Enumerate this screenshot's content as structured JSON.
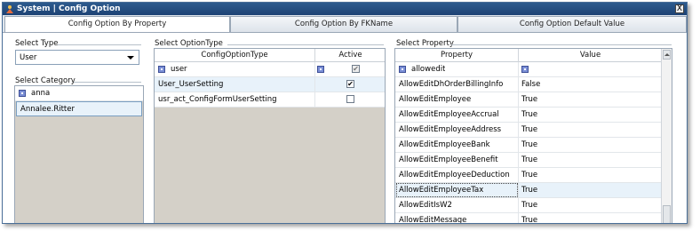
{
  "window": {
    "title": "System | Config Option",
    "close_label": "X"
  },
  "tabs": [
    {
      "label": "Config Option By Property"
    },
    {
      "label": "Config Option By FKName"
    },
    {
      "label": "Config Option Default Value"
    }
  ],
  "select_type": {
    "label": "Select Type",
    "value": "User"
  },
  "select_category": {
    "label": "Select Category",
    "filter_value": "anna",
    "items": [
      "Annalee.Ritter"
    ]
  },
  "select_option_type": {
    "label": "Select OptionType",
    "columns": [
      "ConfigOptionType",
      "Active"
    ],
    "filter_value": "user",
    "rows": [
      {
        "name": "User_UserSetting",
        "active": "✔"
      },
      {
        "name": "usr_act_ConfigFormUserSetting",
        "active": ""
      }
    ]
  },
  "select_property": {
    "label": "Select Property",
    "columns": [
      "Property",
      "Value"
    ],
    "filter_value": "allowedit",
    "rows": [
      {
        "property": "AllowEditDhOrderBillingInfo",
        "value": "False"
      },
      {
        "property": "AllowEditEmployee",
        "value": "True"
      },
      {
        "property": "AllowEditEmployeeAccrual",
        "value": "True"
      },
      {
        "property": "AllowEditEmployeeAddress",
        "value": "True"
      },
      {
        "property": "AllowEditEmployeeBank",
        "value": "True"
      },
      {
        "property": "AllowEditEmployeeBenefit",
        "value": "True"
      },
      {
        "property": "AllowEditEmployeeDeduction",
        "value": "True"
      },
      {
        "property": "AllowEditEmployeeTax",
        "value": "True"
      },
      {
        "property": "AllowEditIsW2",
        "value": "True"
      },
      {
        "property": "AllowEditMessage",
        "value": "True"
      }
    ]
  }
}
